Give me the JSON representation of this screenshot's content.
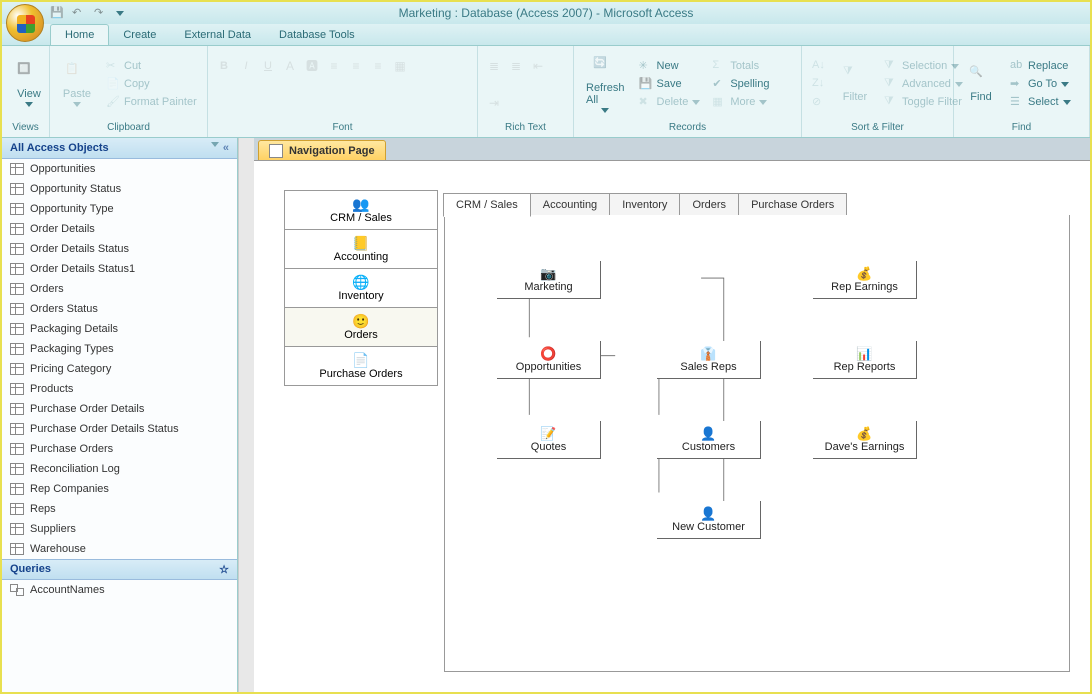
{
  "title": "Marketing : Database (Access 2007) - Microsoft Access",
  "menutabs": [
    "Home",
    "Create",
    "External Data",
    "Database Tools"
  ],
  "ribbon": {
    "views": {
      "label": "Views",
      "btn": "View"
    },
    "clipboard": {
      "label": "Clipboard",
      "paste": "Paste",
      "cut": "Cut",
      "copy": "Copy",
      "fmtp": "Format Painter"
    },
    "font": {
      "label": "Font"
    },
    "richtext": {
      "label": "Rich Text"
    },
    "records": {
      "label": "Records",
      "refresh": "Refresh\nAll",
      "new": "New",
      "save": "Save",
      "delete": "Delete",
      "totals": "Totals",
      "spelling": "Spelling",
      "more": "More"
    },
    "sortfilter": {
      "label": "Sort & Filter",
      "filter": "Filter",
      "selection": "Selection",
      "advanced": "Advanced",
      "toggle": "Toggle Filter"
    },
    "find": {
      "label": "Find",
      "find": "Find",
      "replace": "Replace",
      "goto": "Go To",
      "select": "Select"
    }
  },
  "nav": {
    "header": "All Access Objects",
    "items": [
      "Opportunities",
      "Opportunity Status",
      "Opportunity Type",
      "Order Details",
      "Order Details Status",
      "Order Details Status1",
      "Orders",
      "Orders Status",
      "Packaging Details",
      "Packaging Types",
      "Pricing Category",
      "Products",
      "Purchase Order Details",
      "Purchase Order Details Status",
      "Purchase Orders",
      "Reconciliation Log",
      "Rep Companies",
      "Reps",
      "Suppliers",
      "Warehouse"
    ],
    "queries_header": "Queries",
    "queries": [
      "AccountNames"
    ]
  },
  "doctab": "Navigation Page",
  "navbtns": [
    {
      "label": "CRM / Sales",
      "icon": "👥"
    },
    {
      "label": "Accounting",
      "icon": "📒"
    },
    {
      "label": "Inventory",
      "icon": "🌐"
    },
    {
      "label": "Orders",
      "icon": "🙂"
    },
    {
      "label": "Purchase Orders",
      "icon": "📄"
    }
  ],
  "subtabs": [
    "CRM / Sales",
    "Accounting",
    "Inventory",
    "Orders",
    "Purchase Orders"
  ],
  "nodes": {
    "marketing": "Marketing",
    "opportunities": "Opportunities",
    "quotes": "Quotes",
    "salesreps": "Sales Reps",
    "customers": "Customers",
    "newcustomer": "New Customer",
    "repearnings": "Rep Earnings",
    "repreports": "Rep Reports",
    "davesearnings": "Dave's Earnings"
  }
}
